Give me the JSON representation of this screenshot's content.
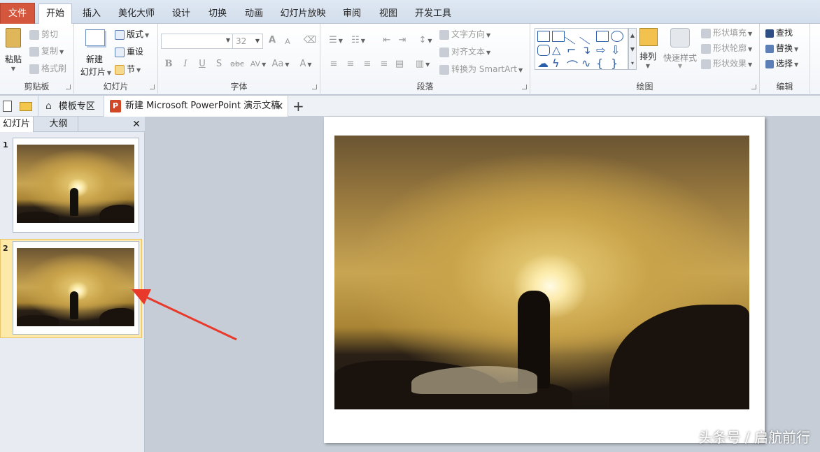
{
  "tabs": [
    "文件",
    "开始",
    "插入",
    "美化大师",
    "设计",
    "切换",
    "动画",
    "幻灯片放映",
    "审阅",
    "视图",
    "开发工具"
  ],
  "ribbon": {
    "clipboard": {
      "paste": "粘贴",
      "cut": "剪切",
      "copy": "复制",
      "format_painter": "格式刷",
      "label": "剪贴板"
    },
    "slides": {
      "new_slide_line1": "新建",
      "new_slide_line2": "幻灯片",
      "layout": "版式",
      "reset": "重设",
      "section": "节",
      "label": "幻灯片"
    },
    "font": {
      "font_size": "32",
      "label": "字体",
      "bold": "B",
      "italic": "I",
      "underline": "U",
      "shadow": "S",
      "strike": "abc",
      "spacing": "AV",
      "case": "Aa",
      "color": "A",
      "grow": "A",
      "shrink": "A"
    },
    "paragraph": {
      "text_direction": "文字方向",
      "align_text": "对齐文本",
      "convert_smartart": "转换为 SmartArt",
      "label": "段落"
    },
    "drawing": {
      "arrange": "排列",
      "quick_styles": "快速样式",
      "shape_fill": "形状填充",
      "shape_outline": "形状轮廓",
      "shape_effects": "形状效果",
      "label": "绘图"
    },
    "editing": {
      "find": "查找",
      "replace": "替换",
      "select": "选择",
      "label": "编辑"
    }
  },
  "doc_tabs": {
    "template_zone": "模板专区",
    "document_title": "新建 Microsoft PowerPoint 演示文稿"
  },
  "left_panel": {
    "tab_slides": "幻灯片",
    "tab_outline": "大纲",
    "close": "✕",
    "slide_numbers": [
      "1",
      "2"
    ]
  },
  "watermark": "头条号 / 启航前行",
  "colors": {
    "file_tab": "#d4563d",
    "arrow": "#e8392b",
    "selected_slide": "#fde9a8"
  }
}
